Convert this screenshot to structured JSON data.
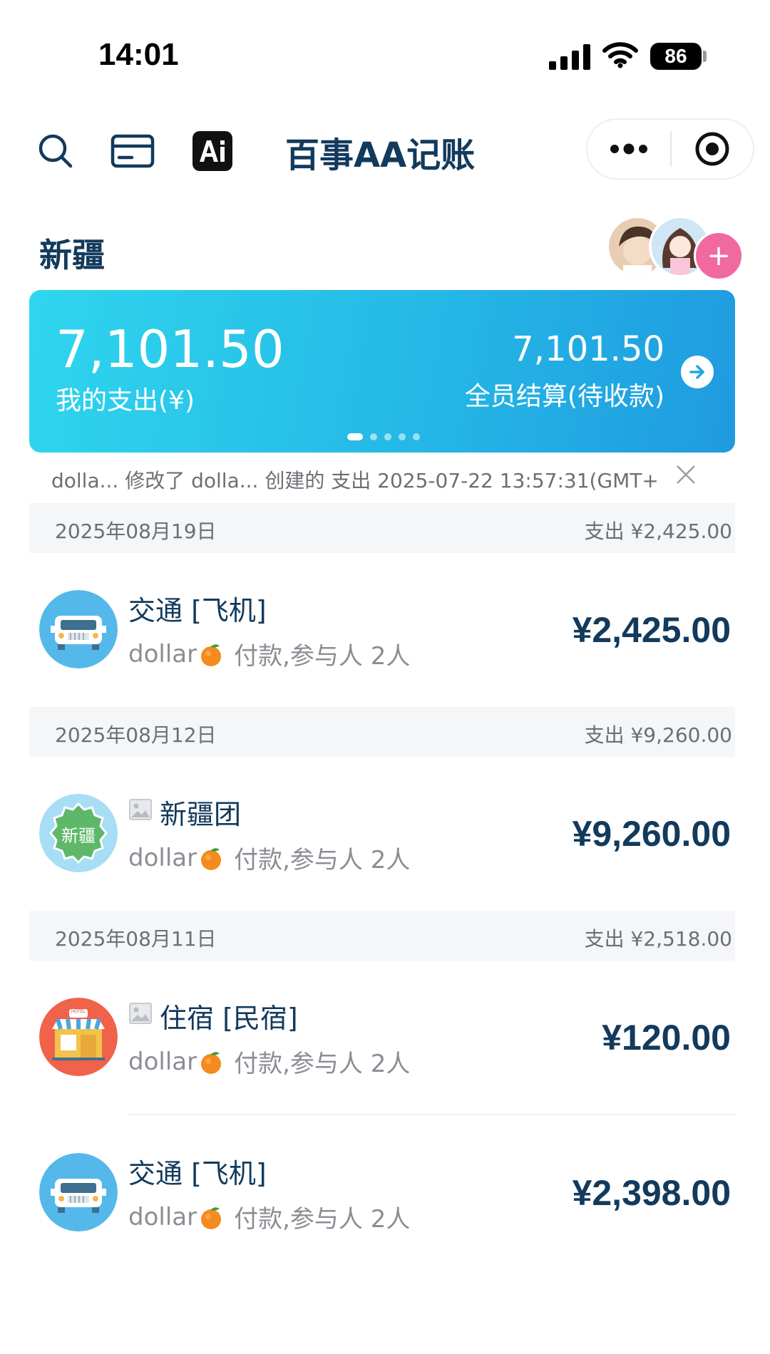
{
  "status_bar": {
    "time": "14:01",
    "battery": "86"
  },
  "header": {
    "title": "百事AA记账"
  },
  "group": {
    "name": "新疆"
  },
  "summary": {
    "my_amount": "7,101.50",
    "my_label": "我的支出(¥)",
    "all_amount": "7,101.50",
    "all_label": "全员结算(待收款)",
    "page_count": 5,
    "active_page": 1
  },
  "notice": {
    "text": "dolla... 修改了 dolla... 创建的 支出  2025-07-22 13:57:31(GMT+"
  },
  "sections": [
    {
      "date": "2025年08月19日",
      "total": "支出 ¥2,425.00",
      "items": [
        {
          "icon": "car-icon",
          "title": "交通 [飞机]",
          "payer": "dollar",
          "detail": "付款,参与人 2人",
          "amount": "¥2,425.00"
        }
      ]
    },
    {
      "date": "2025年08月12日",
      "total": "支出 ¥9,260.00",
      "items": [
        {
          "icon": "badge-icon",
          "icon_text": "新疆",
          "has_image": true,
          "title": "新疆团",
          "payer": "dollar",
          "detail": "付款,参与人 2人",
          "amount": "¥9,260.00"
        }
      ]
    },
    {
      "date": "2025年08月11日",
      "total": "支出 ¥2,518.00",
      "items": [
        {
          "icon": "hotel-icon",
          "icon_text": "HOTEL",
          "has_image": true,
          "title": "住宿 [民宿]",
          "payer": "dollar",
          "detail": "付款,参与人 2人",
          "amount": "¥120.00"
        },
        {
          "icon": "car-icon",
          "title": "交通 [飞机]",
          "payer": "dollar",
          "detail": "付款,参与人 2人",
          "amount": "¥2,398.00"
        }
      ]
    }
  ],
  "colors": {
    "primary_text": "#123a5c",
    "card_start": "#2fd6ee",
    "card_end": "#1f9be0",
    "add_button": "#f06aa0"
  }
}
